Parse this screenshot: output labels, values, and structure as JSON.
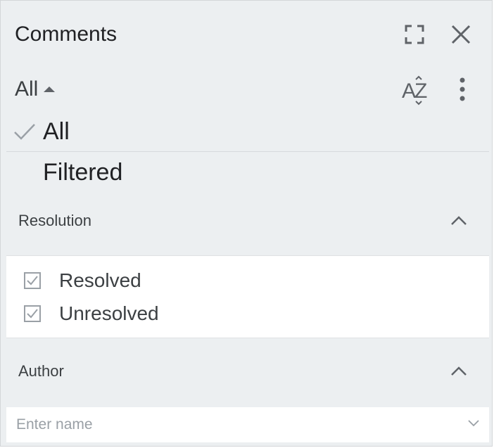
{
  "panel": {
    "title": "Comments",
    "icons": {
      "expand": "expand-icon",
      "close": "close-icon",
      "sort": "sort-az-icon",
      "more": "more-vertical-icon"
    }
  },
  "filter": {
    "selected": "All",
    "options": [
      {
        "label": "All",
        "checked": true
      },
      {
        "label": "Filtered",
        "checked": false
      }
    ]
  },
  "sections": {
    "resolution": {
      "title": "Resolution",
      "expanded": true,
      "items": [
        {
          "label": "Resolved",
          "checked": true
        },
        {
          "label": "Unresolved",
          "checked": true
        }
      ]
    },
    "author": {
      "title": "Author",
      "expanded": true,
      "input": {
        "value": "",
        "placeholder": "Enter name"
      }
    }
  },
  "colors": {
    "panel_bg": "#eceff1",
    "text": "#202124",
    "muted": "#9aa0a6",
    "surface": "#ffffff"
  }
}
